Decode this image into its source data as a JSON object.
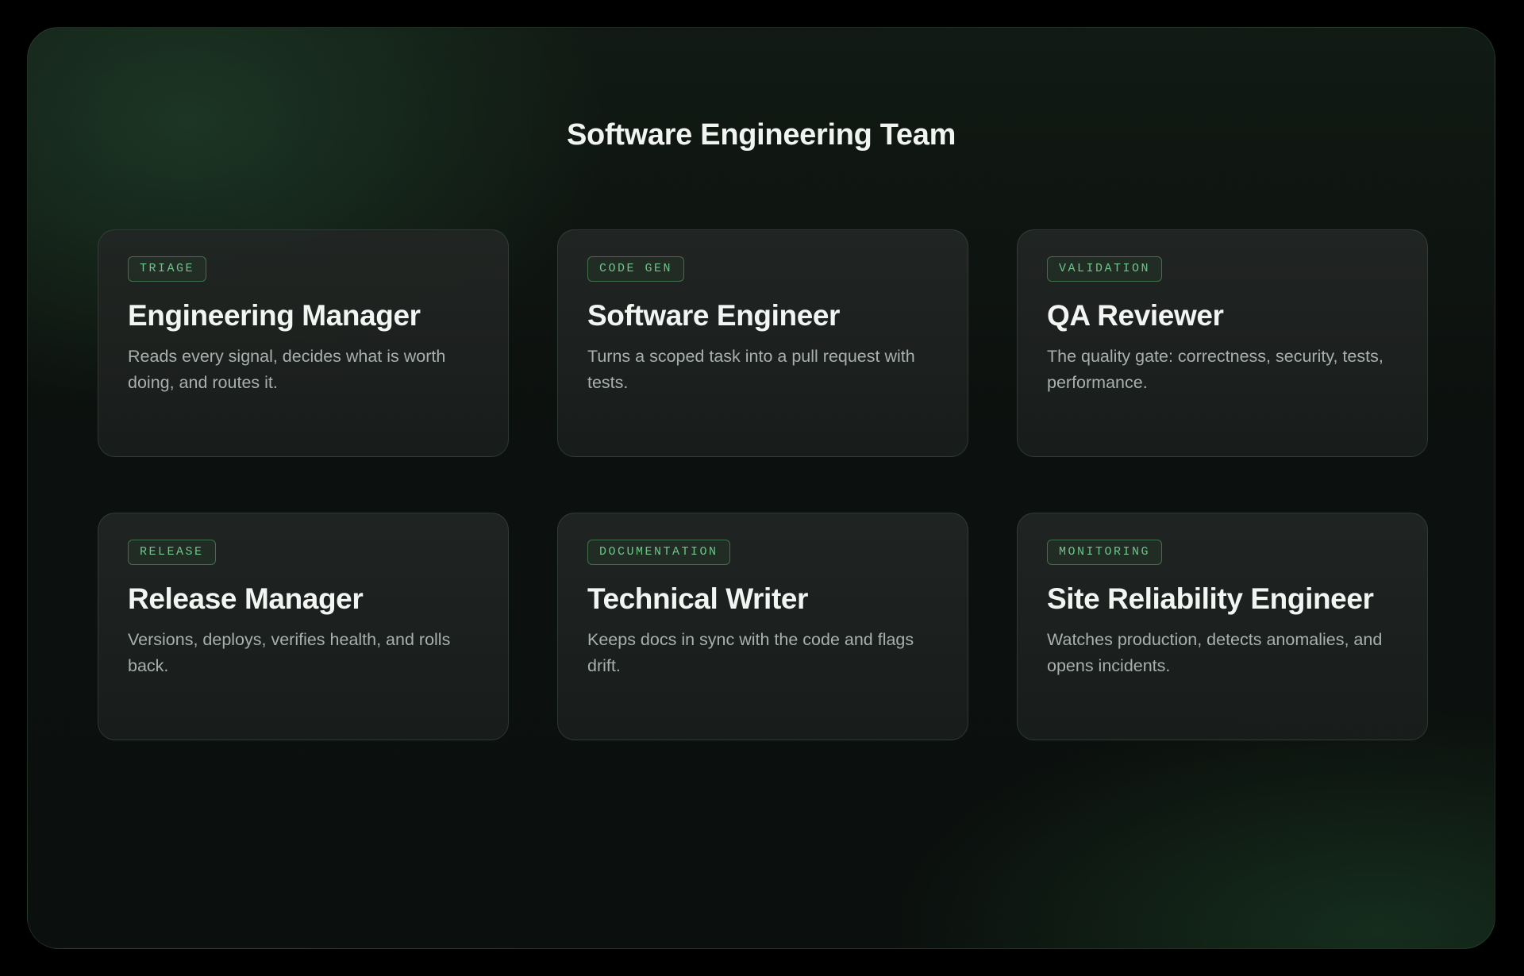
{
  "page": {
    "title": "Software Engineering Team"
  },
  "colors": {
    "background": "#000000",
    "panel": "#0c100e",
    "card": "#1e2220",
    "accent_green": "#6ec489",
    "title_text": "#f2f4f2",
    "body_text": "#a9b0ac"
  },
  "cards": [
    {
      "tag": "TRIAGE",
      "title": "Engineering Manager",
      "description": "Reads every signal, decides what is worth doing, and routes it."
    },
    {
      "tag": "CODE GEN",
      "title": "Software Engineer",
      "description": "Turns a scoped task into a pull request with tests."
    },
    {
      "tag": "VALIDATION",
      "title": "QA Reviewer",
      "description": "The quality gate: correctness, security, tests, performance."
    },
    {
      "tag": "RELEASE",
      "title": "Release Manager",
      "description": "Versions, deploys, verifies health, and rolls back."
    },
    {
      "tag": "DOCUMENTATION",
      "title": "Technical Writer",
      "description": "Keeps docs in sync with the code and flags drift."
    },
    {
      "tag": "MONITORING",
      "title": "Site Reliability Engineer",
      "description": "Watches production, detects anomalies, and opens incidents."
    }
  ]
}
